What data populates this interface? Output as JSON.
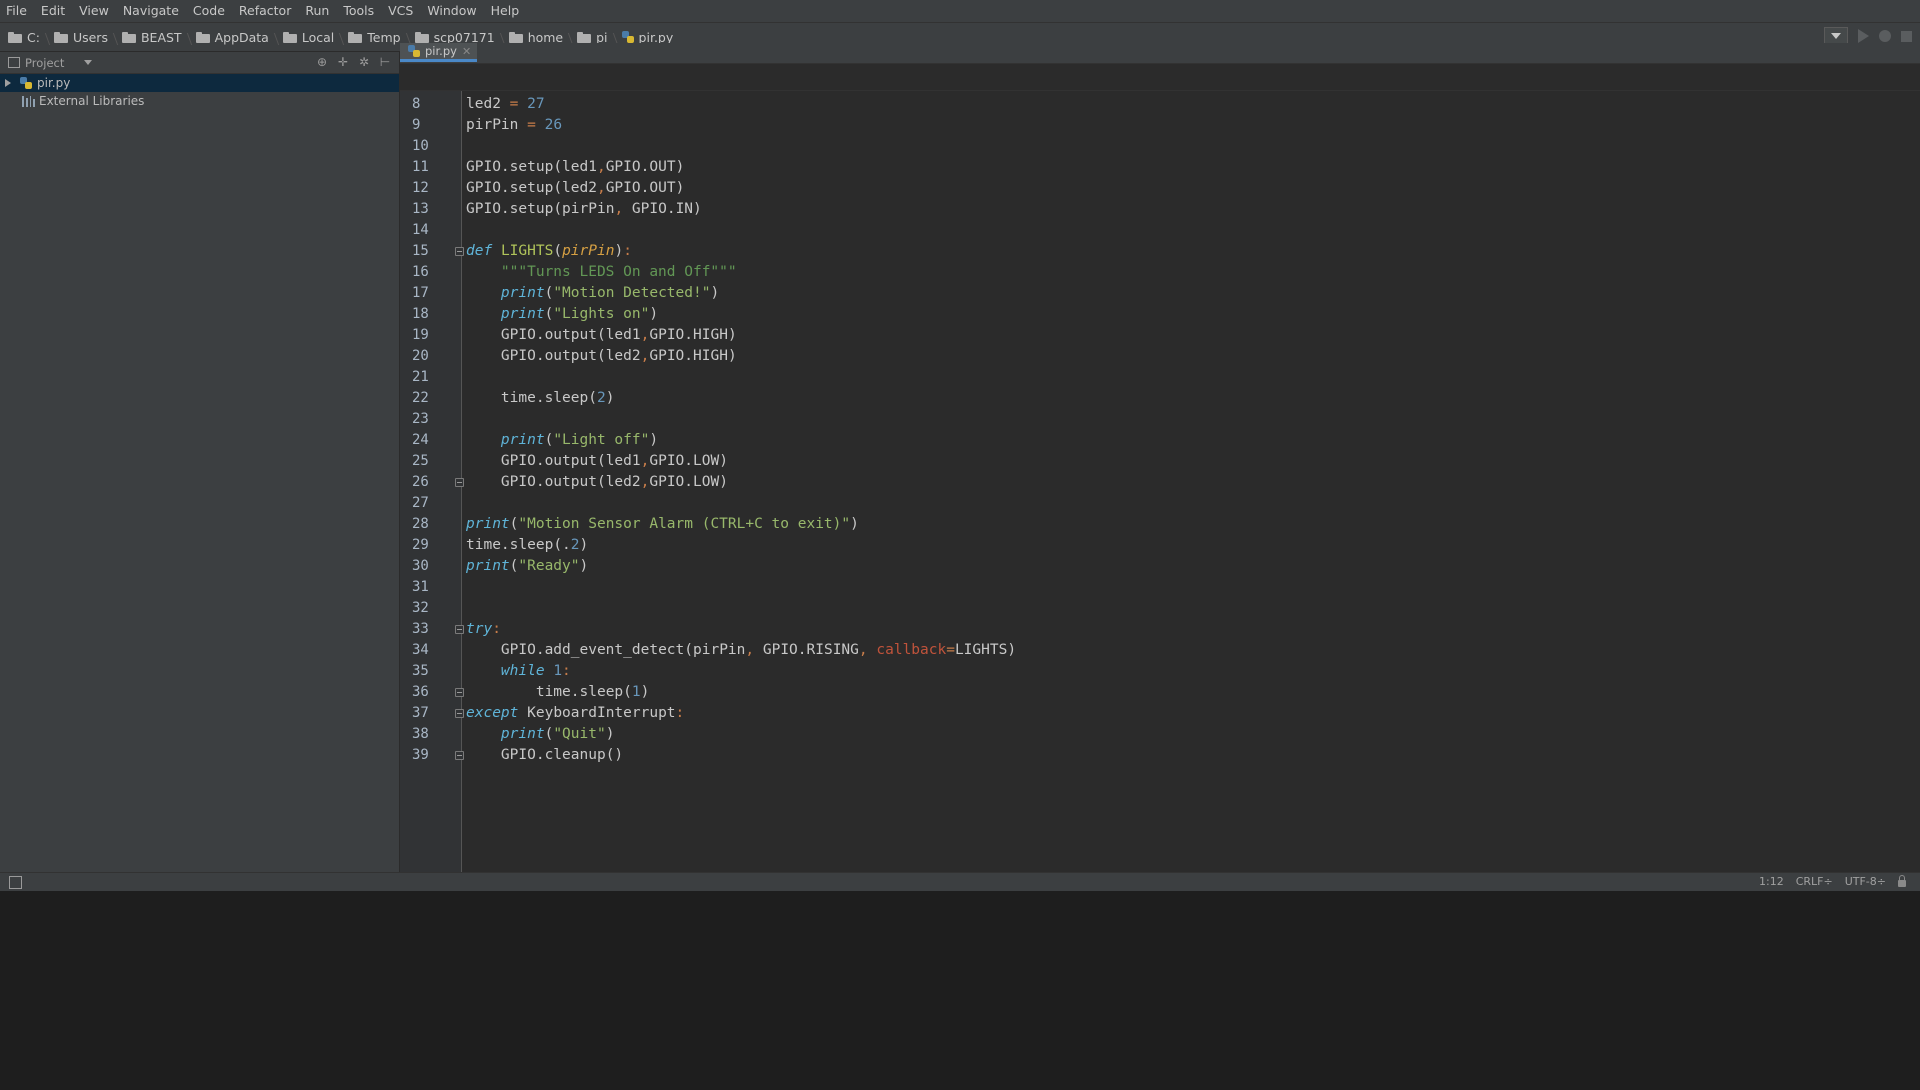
{
  "menubar": {
    "items": [
      "File",
      "Edit",
      "View",
      "Navigate",
      "Code",
      "Refactor",
      "Run",
      "Tools",
      "VCS",
      "Window",
      "Help"
    ]
  },
  "breadcrumb": {
    "items": [
      "C:",
      "Users",
      "BEAST",
      "AppData",
      "Local",
      "Temp",
      "scp07171",
      "home",
      "pi",
      "pir.py"
    ]
  },
  "project_panel": {
    "title": "Project",
    "tree": [
      {
        "label": "pir.py",
        "type": "file",
        "selected": true
      },
      {
        "label": "External Libraries",
        "type": "library",
        "selected": false
      }
    ]
  },
  "editor": {
    "active_tab": "pir.py",
    "lines": [
      {
        "n": "8",
        "code": "led2 = 27"
      },
      {
        "n": "9",
        "code": "pirPin = 26"
      },
      {
        "n": "10",
        "code": ""
      },
      {
        "n": "11",
        "code": "GPIO.setup(led1,GPIO.OUT)"
      },
      {
        "n": "12",
        "code": "GPIO.setup(led2,GPIO.OUT)"
      },
      {
        "n": "13",
        "code": "GPIO.setup(pirPin, GPIO.IN)"
      },
      {
        "n": "14",
        "code": ""
      },
      {
        "n": "15",
        "code": "def LIGHTS(pirPin):"
      },
      {
        "n": "16",
        "code": "    \"\"\"Turns LEDS On and Off\"\"\""
      },
      {
        "n": "17",
        "code": "    print(\"Motion Detected!\")"
      },
      {
        "n": "18",
        "code": "    print(\"Lights on\")"
      },
      {
        "n": "19",
        "code": "    GPIO.output(led1,GPIO.HIGH)"
      },
      {
        "n": "20",
        "code": "    GPIO.output(led2,GPIO.HIGH)"
      },
      {
        "n": "21",
        "code": ""
      },
      {
        "n": "22",
        "code": "    time.sleep(2)"
      },
      {
        "n": "23",
        "code": ""
      },
      {
        "n": "24",
        "code": "    print(\"Light off\")"
      },
      {
        "n": "25",
        "code": "    GPIO.output(led1,GPIO.LOW)"
      },
      {
        "n": "26",
        "code": "    GPIO.output(led2,GPIO.LOW)"
      },
      {
        "n": "27",
        "code": ""
      },
      {
        "n": "28",
        "code": "print(\"Motion Sensor Alarm (CTRL+C to exit)\")"
      },
      {
        "n": "29",
        "code": "time.sleep(.2)"
      },
      {
        "n": "30",
        "code": "print(\"Ready\")"
      },
      {
        "n": "31",
        "code": ""
      },
      {
        "n": "32",
        "code": ""
      },
      {
        "n": "33",
        "code": "try:"
      },
      {
        "n": "34",
        "code": "    GPIO.add_event_detect(pirPin, GPIO.RISING, callback=LIGHTS)"
      },
      {
        "n": "35",
        "code": "    while 1:"
      },
      {
        "n": "36",
        "code": "        time.sleep(1)"
      },
      {
        "n": "37",
        "code": "except KeyboardInterrupt:"
      },
      {
        "n": "38",
        "code": "    print(\"Quit\")"
      },
      {
        "n": "39",
        "code": "    GPIO.cleanup()"
      }
    ]
  },
  "statusbar": {
    "position": "1:12",
    "line_separator": "CRLF÷",
    "encoding": "UTF-8÷"
  },
  "colors": {
    "editor_bg": "#2b2b2b",
    "panel_bg": "#3c3f41",
    "selection": "#0d293e",
    "tab_underline": "#4a88c7"
  }
}
